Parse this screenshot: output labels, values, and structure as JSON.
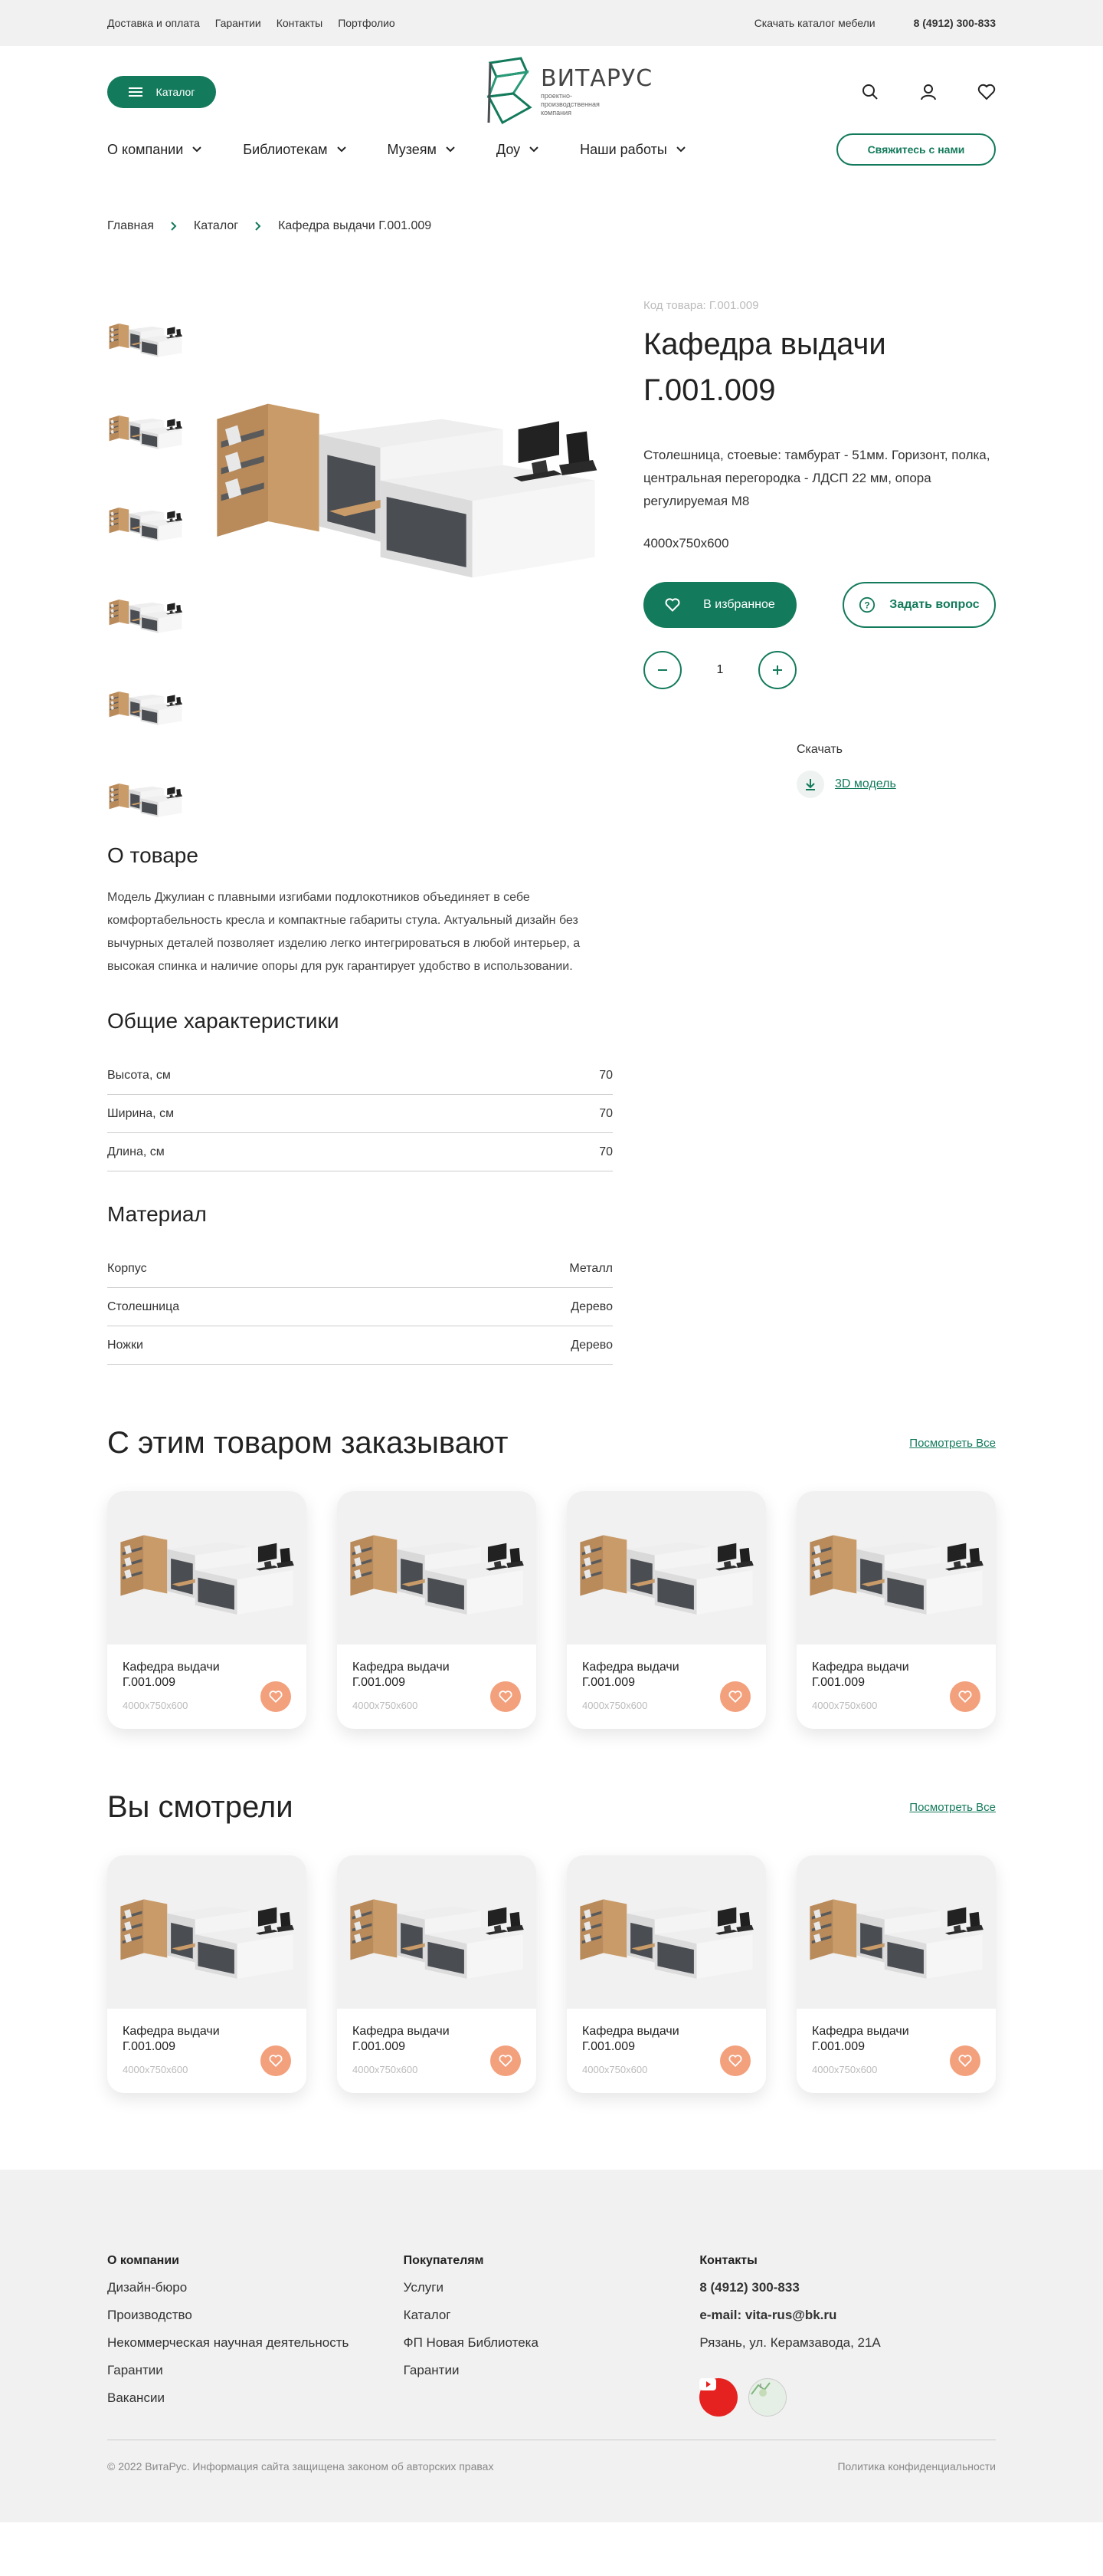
{
  "topbar": {
    "links": [
      "Доставка и оплата",
      "Гарантии",
      "Контакты",
      "Портфолио"
    ],
    "download_catalog": "Скачать каталог мебели",
    "phone": "8 (4912) 300-833"
  },
  "header": {
    "catalog_label": "Каталог",
    "logo_name": "ВИТАРУС",
    "logo_sub": "проектно-производственная компания",
    "nav": [
      "О компании",
      "Библиотекам",
      "Музеям",
      "Доу",
      "Наши работы"
    ],
    "contact_label": "Свяжитесь с нами"
  },
  "breadcrumb": [
    "Главная",
    "Каталог",
    "Кафедра выдачи Г.001.009"
  ],
  "product": {
    "code": "Код товара: Г.001.009",
    "title": "Кафедра выдачи Г.001.009",
    "description": "Столешница, стоевые: тамбурат - 51мм. Горизонт, полка, центральная перегородка - ЛДСП 22 мм, опора регулируемая М8",
    "dimensions": "4000х750х600",
    "favorite_label": "В избранное",
    "ask_label": "Задать вопрос",
    "quantity": "1",
    "download_label": "Скачать",
    "model_label": "3D модель"
  },
  "about": {
    "heading": "О товаре",
    "text": "Модель Джулиан с плавными изгибами подлокотников объединяет в себе комфортабельность кресла и компактные габариты стула. Актуальный дизайн без вычурных деталей позволяет изделию легко интегрироваться в любой интерьер, а высокая спинка и наличие опоры для рук гарантирует удобство в использовании."
  },
  "specs": {
    "heading": "Общие характеристики",
    "rows": [
      {
        "label": "Высота, см",
        "value": "70"
      },
      {
        "label": "Ширина, см",
        "value": "70"
      },
      {
        "label": "Длина, см",
        "value": "70"
      }
    ]
  },
  "material": {
    "heading": "Материал",
    "rows": [
      {
        "label": "Корпус",
        "value": "Металл"
      },
      {
        "label": "Столешница",
        "value": "Дерево"
      },
      {
        "label": "Ножки",
        "value": "Дерево"
      }
    ]
  },
  "related": {
    "heading": "С этим товаром заказывают",
    "see_all": "Посмотреть Все",
    "cards": [
      {
        "title": "Кафедра выдачи Г.001.009",
        "dims": "4000х750х600"
      },
      {
        "title": "Кафедра выдачи Г.001.009",
        "dims": "4000х750х600"
      },
      {
        "title": "Кафедра выдачи Г.001.009",
        "dims": "4000х750х600"
      },
      {
        "title": "Кафедра выдачи Г.001.009",
        "dims": "4000х750х600"
      }
    ]
  },
  "viewed": {
    "heading": "Вы смотрели",
    "see_all": "Посмотреть Все",
    "cards": [
      {
        "title": "Кафедра выдачи Г.001.009",
        "dims": "4000х750х600"
      },
      {
        "title": "Кафедра выдачи Г.001.009",
        "dims": "4000х750х600"
      },
      {
        "title": "Кафедра выдачи Г.001.009",
        "dims": "4000х750х600"
      },
      {
        "title": "Кафедра выдачи Г.001.009",
        "dims": "4000х750х600"
      }
    ]
  },
  "footer": {
    "company": {
      "heading": "О компании",
      "links": [
        "Дизайн-бюро",
        "Производство",
        "Некоммерческая научная деятельность",
        "Гарантии",
        "Вакансии"
      ]
    },
    "buyers": {
      "heading": "Покупателям",
      "links": [
        "Услуги",
        "Каталог",
        "ФП Новая Библиотека",
        "Гарантии"
      ]
    },
    "contacts": {
      "heading": "Контакты",
      "phone": "8 (4912) 300-833",
      "email": "e-mail: vita-rus@bk.ru",
      "address": "Рязань, ул. Керамзавода, 21А"
    },
    "copyright": "© 2022 ВитаРус. Информация сайта защищена законом об авторских правах",
    "privacy": "Политика конфиденциальности"
  },
  "colors": {
    "brand": "#137a5b",
    "heart": "#f3a07d",
    "youtube": "#e52220"
  },
  "icons": [
    "burger-icon",
    "search-icon",
    "user-icon",
    "heart-icon",
    "chevron-down-icon",
    "chevron-right-icon",
    "question-icon",
    "minus-icon",
    "plus-icon",
    "download-icon",
    "youtube-icon",
    "map-icon"
  ]
}
